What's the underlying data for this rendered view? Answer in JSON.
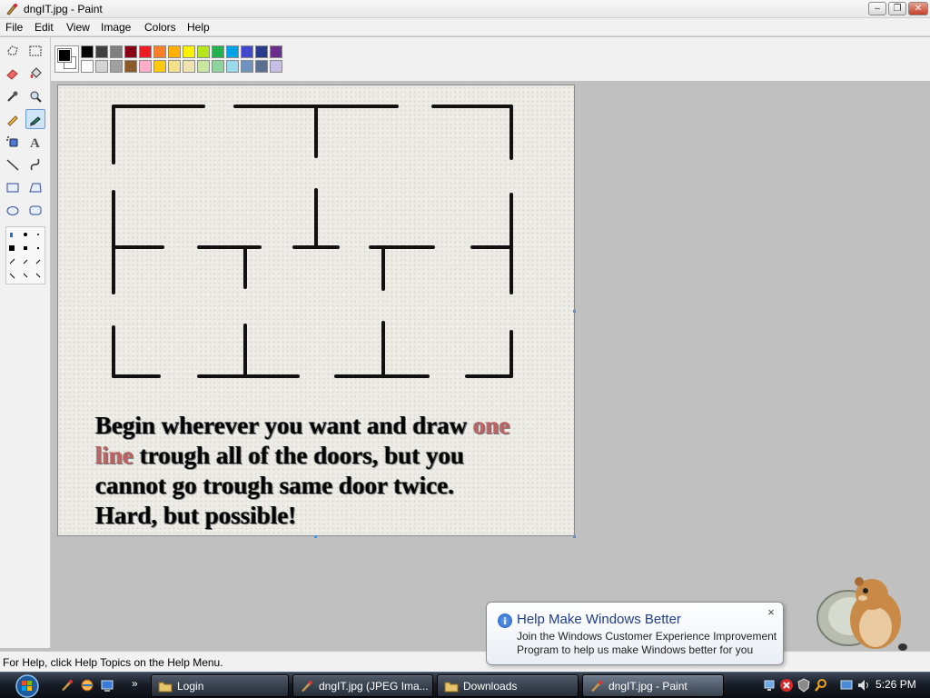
{
  "window": {
    "title": "dngIT.jpg - Paint",
    "controls": {
      "minimize": "–",
      "maximize": "❐",
      "close": "✕"
    }
  },
  "menu": [
    "File",
    "Edit",
    "View",
    "Image",
    "Colors",
    "Help"
  ],
  "tools": [
    "free-form-select",
    "select",
    "eraser",
    "fill",
    "pick-color",
    "magnifier",
    "pencil",
    "brush",
    "airbrush",
    "text",
    "line",
    "curve",
    "rectangle",
    "polygon",
    "ellipse",
    "rounded-rectangle"
  ],
  "selected_tool": "brush",
  "palette": {
    "foreground": "#000000",
    "background": "#ffffff",
    "top_row": [
      "#000000",
      "#404040",
      "#7f7f7f",
      "#880015",
      "#ed1c24",
      "#ff7f27",
      "#ffb000",
      "#fff200",
      "#b5e61d",
      "#22b14c",
      "#00a2e8",
      "#3f48cc",
      "#2a3a8c",
      "#6a2f8c"
    ],
    "bottom_row": [
      "#ffffff",
      "#d3d3d3",
      "#a0a0a0",
      "#8b5a2b",
      "#ffaec9",
      "#ffc90e",
      "#f5e08c",
      "#efe4b0",
      "#c8e6a0",
      "#8fd49e",
      "#99d9ea",
      "#7092be",
      "#5a7090",
      "#c8bfe7"
    ]
  },
  "canvas_text": {
    "line1_a": "Begin wherever you want and draw ",
    "line1_hl": "one",
    "line2_hl": "line",
    "line2_b": " trough all of the doors, but you",
    "line3": "cannot go trough same door twice.",
    "line4": "Hard, but possible!"
  },
  "status": "For Help, click Help Topics on the Help Menu.",
  "balloon": {
    "title": "Help Make Windows Better",
    "body": "Join the Windows Customer Experience Improvement Program to help us make Windows better for you",
    "close": "×"
  },
  "taskbar": {
    "chevron": "»",
    "buttons": [
      {
        "label": "Login",
        "icon": "folder-icon"
      },
      {
        "label": "dngIT.jpg (JPEG Ima...",
        "icon": "paint-icon"
      },
      {
        "label": "Downloads",
        "icon": "folder-icon"
      },
      {
        "label": "dngIT.jpg - Paint",
        "icon": "paint-icon",
        "active": true
      }
    ],
    "clock": "5:26 PM"
  }
}
